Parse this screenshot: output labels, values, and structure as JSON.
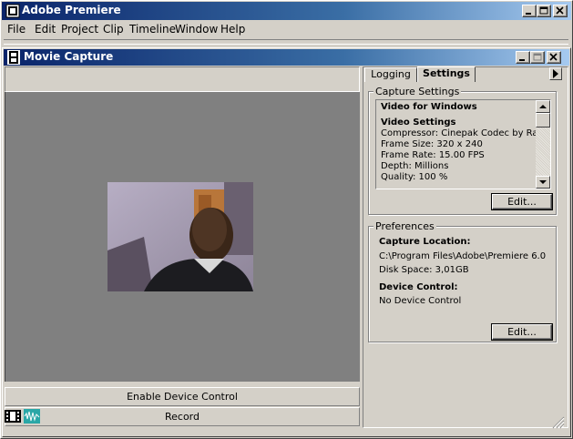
{
  "app": {
    "title": "Adobe Premiere"
  },
  "menu": [
    "File",
    "Edit",
    "Project",
    "Clip",
    "Timeline",
    "Window",
    "Help"
  ],
  "capture_window": {
    "title": "Movie Capture",
    "enable_device_control_label": "Enable Device Control",
    "record_label": "Record"
  },
  "tabs": {
    "logging": "Logging",
    "settings": "Settings"
  },
  "capture_settings": {
    "group_label": "Capture Settings",
    "heading": "Video for Windows",
    "subheading": "Video Settings",
    "compressor": "Compressor: Cinepak Codec by Radius",
    "frame_size": "Frame Size: 320 x 240",
    "frame_rate": "Frame Rate: 15.00 FPS",
    "depth": "Depth: Millions",
    "quality": "Quality: 100 %",
    "edit_label": "Edit..."
  },
  "preferences": {
    "group_label": "Preferences",
    "capture_location_label": "Capture Location:",
    "capture_location_path": "C:\\Program Files\\Adobe\\Premiere 6.0",
    "disk_space": "Disk Space: 3,01GB",
    "device_control_label": "Device Control:",
    "device_control_value": "No Device Control",
    "edit_label": "Edit..."
  },
  "colors": {
    "title_active": "#0a246a",
    "title_gradient_end": "#a6caf0",
    "face": "#d4d0c8",
    "preview_bg": "#808080",
    "status_icon_teal": "#2aa7a7"
  },
  "icons": {
    "app": "premiere-icon",
    "window": "film-icon",
    "minimize": "minimize-icon",
    "maximize": "maximize-icon",
    "close": "close-icon",
    "film_status": "film-strip-icon",
    "audio_status": "audio-waveform-icon",
    "tab_menu": "triangle-right-icon"
  }
}
